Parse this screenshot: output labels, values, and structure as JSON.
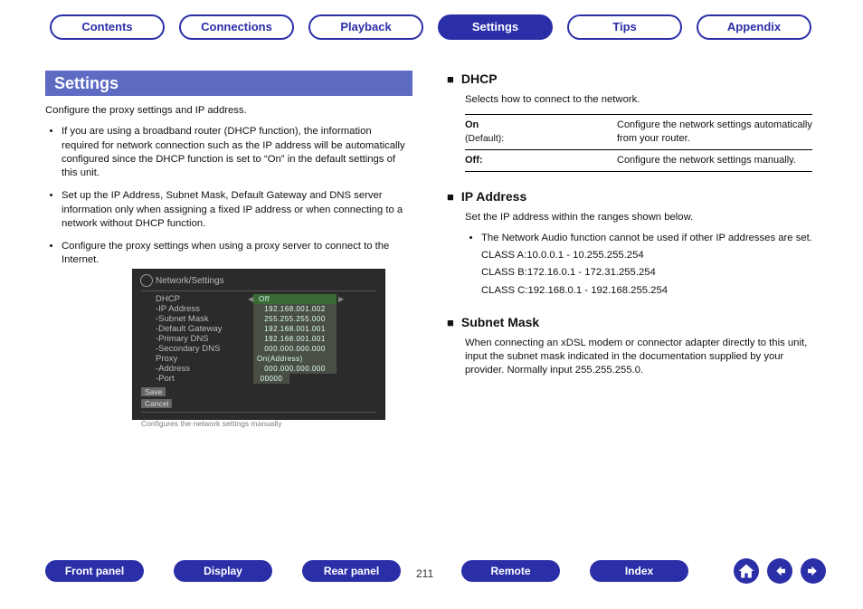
{
  "tabs": {
    "t0": "Contents",
    "t1": "Connections",
    "t2": "Playback",
    "t3": "Settings",
    "t4": "Tips",
    "t5": "Appendix"
  },
  "section_title": "Settings",
  "left": {
    "intro": "Configure the proxy settings and IP address.",
    "b1": "If you are using a broadband router (DHCP function), the information required for network connection such as the IP address will be automatically configured since the DHCP function is set to “On” in the default settings of this unit.",
    "b2": "Set up the IP Address, Subnet Mask, Default Gateway and DNS server information only when assigning a fixed IP address or when connecting to a network without DHCP function.",
    "b3": "Configure the proxy settings when using a proxy server to connect to the Internet."
  },
  "osd": {
    "title": "Network/Settings",
    "rows": [
      {
        "label": "DHCP",
        "value": "Off"
      },
      {
        "label": "-IP Address",
        "value": "192.168.001.002"
      },
      {
        "label": "-Subnet Mask",
        "value": "255.255.255.000"
      },
      {
        "label": "-Default Gateway",
        "value": "192.168.001.001"
      },
      {
        "label": "-Primary DNS",
        "value": "192.168.001.001"
      },
      {
        "label": "-Secondary DNS",
        "value": "000.000.000.000"
      },
      {
        "label": "Proxy",
        "value": "On(Address)"
      },
      {
        "label": "-Address",
        "value": "000.000.000.000"
      },
      {
        "label": "-Port",
        "value": "00000"
      }
    ],
    "save": "Save",
    "cancel": "Cancel",
    "footer": "Configures the network settings manually"
  },
  "right": {
    "dhcp": {
      "title": "DHCP",
      "desc": "Selects how to connect to the network.",
      "on_label": "On",
      "on_default": "(Default):",
      "on_desc": "Configure the network settings automatically from your router.",
      "off_label": "Off:",
      "off_desc": "Configure the network settings manually."
    },
    "ip": {
      "title": "IP Address",
      "desc": "Set the IP address within the ranges shown below.",
      "note": "The Network Audio function cannot be used if other IP addresses are set.",
      "classA": "CLASS A:10.0.0.1 - 10.255.255.254",
      "classB": "CLASS B:172.16.0.1 - 172.31.255.254",
      "classC": "CLASS C:192.168.0.1 - 192.168.255.254"
    },
    "subnet": {
      "title": "Subnet Mask",
      "desc": "When connecting an xDSL modem or connector adapter directly to this unit, input the subnet mask indicated in the documentation supplied by your provider. Normally input 255.255.255.0."
    }
  },
  "bottom": {
    "front": "Front panel",
    "display": "Display",
    "rear": "Rear panel",
    "remote": "Remote",
    "index": "Index",
    "page": "211"
  }
}
